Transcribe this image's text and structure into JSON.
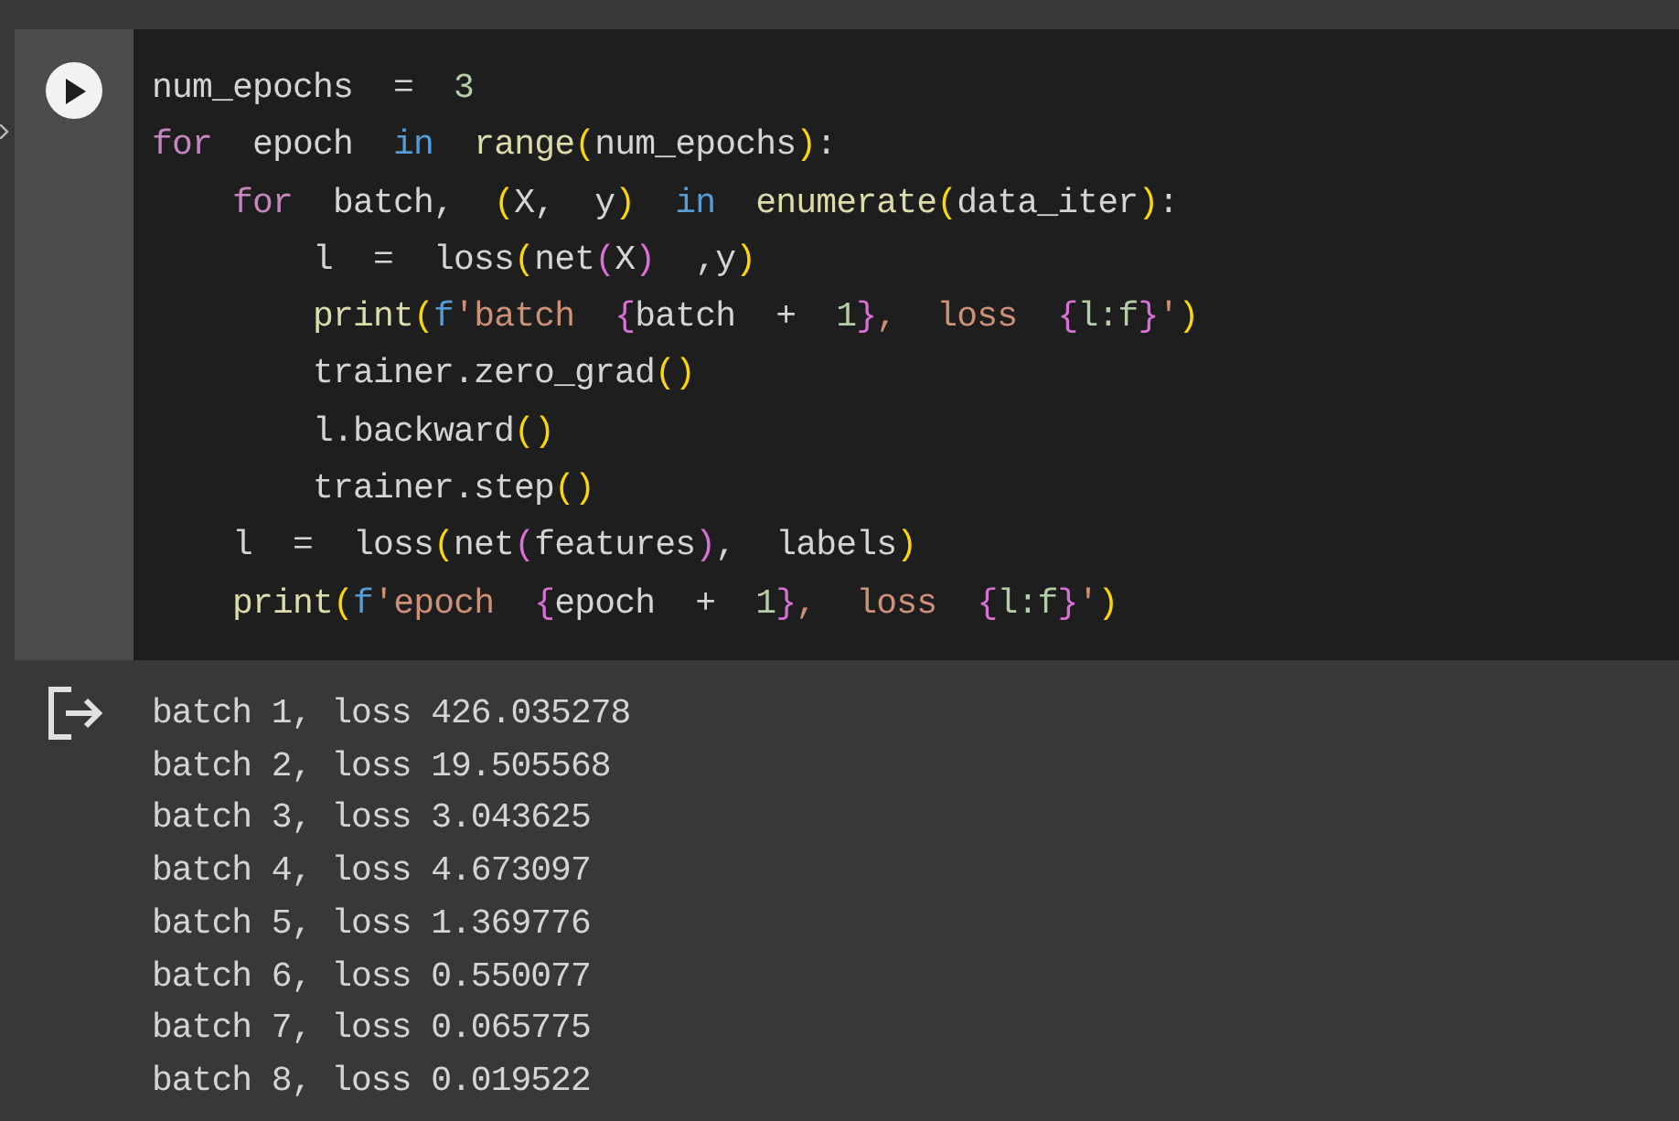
{
  "code_cell": {
    "lines": [
      [
        {
          "text": "num_epochs  =  ",
          "kind": "plain"
        },
        {
          "text": "3",
          "kind": "number"
        }
      ],
      [
        {
          "text": "for",
          "kind": "keyword"
        },
        {
          "text": "  epoch  ",
          "kind": "plain"
        },
        {
          "text": "in",
          "kind": "operator"
        },
        {
          "text": "  range",
          "kind": "builtin"
        },
        {
          "text": "(",
          "kind": "paren"
        },
        {
          "text": "num_epochs",
          "kind": "plain"
        },
        {
          "text": ")",
          "kind": "paren"
        },
        {
          "text": ":",
          "kind": "plain"
        }
      ],
      [
        {
          "text": "    for",
          "kind": "keyword"
        },
        {
          "text": "  batch,  ",
          "kind": "plain"
        },
        {
          "text": "(",
          "kind": "paren"
        },
        {
          "text": "X,  y",
          "kind": "plain"
        },
        {
          "text": ")",
          "kind": "paren"
        },
        {
          "text": "  in",
          "kind": "operator"
        },
        {
          "text": "  enumerate",
          "kind": "builtin"
        },
        {
          "text": "(",
          "kind": "paren"
        },
        {
          "text": "data_iter",
          "kind": "plain"
        },
        {
          "text": ")",
          "kind": "paren"
        },
        {
          "text": ":",
          "kind": "plain"
        }
      ],
      [
        {
          "text": "        l  =  loss",
          "kind": "plain"
        },
        {
          "text": "(",
          "kind": "paren"
        },
        {
          "text": "net",
          "kind": "plain"
        },
        {
          "text": "(",
          "kind": "paren2"
        },
        {
          "text": "X",
          "kind": "plain"
        },
        {
          "text": ")",
          "kind": "paren2"
        },
        {
          "text": "  ,y",
          "kind": "plain"
        },
        {
          "text": ")",
          "kind": "paren"
        }
      ],
      [
        {
          "text": "        print",
          "kind": "builtin"
        },
        {
          "text": "(",
          "kind": "paren"
        },
        {
          "text": "f",
          "kind": "prefix"
        },
        {
          "text": "'batch  ",
          "kind": "string"
        },
        {
          "text": "{",
          "kind": "paren2"
        },
        {
          "text": "batch  +  ",
          "kind": "plain"
        },
        {
          "text": "1",
          "kind": "number"
        },
        {
          "text": "}",
          "kind": "paren2"
        },
        {
          "text": ",  loss  ",
          "kind": "string"
        },
        {
          "text": "{",
          "kind": "paren2"
        },
        {
          "text": "l:f",
          "kind": "number"
        },
        {
          "text": "}",
          "kind": "paren2"
        },
        {
          "text": "'",
          "kind": "string"
        },
        {
          "text": ")",
          "kind": "paren"
        }
      ],
      [
        {
          "text": "        trainer.zero_grad",
          "kind": "plain"
        },
        {
          "text": "()",
          "kind": "paren"
        }
      ],
      [
        {
          "text": "        l.backward",
          "kind": "plain"
        },
        {
          "text": "()",
          "kind": "paren"
        }
      ],
      [
        {
          "text": "        trainer.step",
          "kind": "plain"
        },
        {
          "text": "()",
          "kind": "paren"
        }
      ],
      [
        {
          "text": "    l  =  loss",
          "kind": "plain"
        },
        {
          "text": "(",
          "kind": "paren"
        },
        {
          "text": "net",
          "kind": "plain"
        },
        {
          "text": "(",
          "kind": "paren2"
        },
        {
          "text": "features",
          "kind": "plain"
        },
        {
          "text": ")",
          "kind": "paren2"
        },
        {
          "text": ",  labels",
          "kind": "plain"
        },
        {
          "text": ")",
          "kind": "paren"
        }
      ],
      [
        {
          "text": "    print",
          "kind": "builtin"
        },
        {
          "text": "(",
          "kind": "paren"
        },
        {
          "text": "f",
          "kind": "prefix"
        },
        {
          "text": "'epoch  ",
          "kind": "string"
        },
        {
          "text": "{",
          "kind": "paren2"
        },
        {
          "text": "epoch  +  ",
          "kind": "plain"
        },
        {
          "text": "1",
          "kind": "number"
        },
        {
          "text": "}",
          "kind": "paren2"
        },
        {
          "text": ",  loss  ",
          "kind": "string"
        },
        {
          "text": "{",
          "kind": "paren2"
        },
        {
          "text": "l:f",
          "kind": "number"
        },
        {
          "text": "}",
          "kind": "paren2"
        },
        {
          "text": "'",
          "kind": "string"
        },
        {
          "text": ")",
          "kind": "paren"
        }
      ]
    ]
  },
  "output": {
    "lines": [
      "batch 1, loss 426.035278",
      "batch 2, loss 19.505568",
      "batch 3, loss 3.043625",
      "batch 4, loss 4.673097",
      "batch 5, loss 1.369776",
      "batch 6, loss 0.550077",
      "batch 7, loss 0.065775",
      "batch 8, loss 0.019522"
    ]
  }
}
